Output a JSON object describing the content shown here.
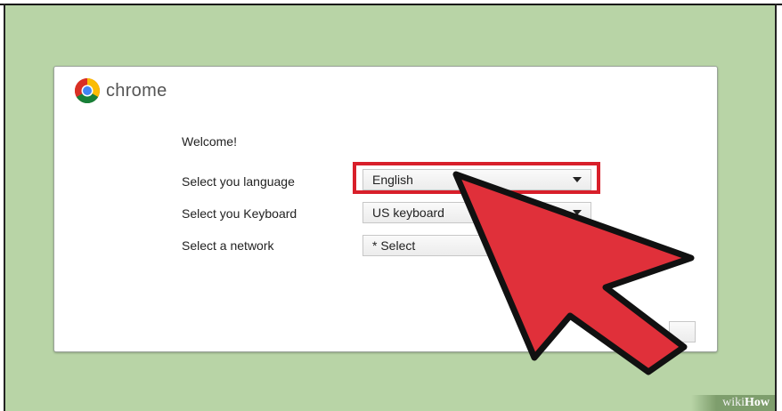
{
  "brand": {
    "name": "chrome"
  },
  "setup": {
    "welcome": "Welcome!",
    "language": {
      "label": "Select you language",
      "value": "English"
    },
    "keyboard": {
      "label": "Select you Keyboard",
      "value": "US keyboard"
    },
    "network": {
      "label": "Select a network",
      "value": "*  Select"
    }
  },
  "watermark": {
    "wiki": "wiki",
    "how": "How"
  },
  "colors": {
    "background": "#b8d4a6",
    "highlight": "#d81f2a",
    "arrow": "#e0303a"
  }
}
